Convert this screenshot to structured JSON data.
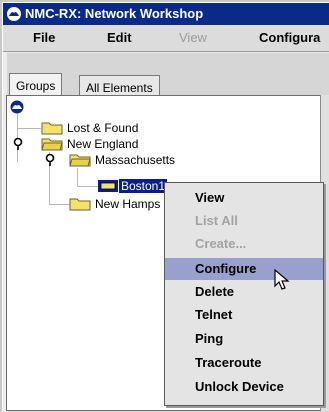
{
  "window": {
    "title": "NMC-RX: Network Workshop"
  },
  "menubar": {
    "items": [
      {
        "label": "File",
        "enabled": true
      },
      {
        "label": "Edit",
        "enabled": true
      },
      {
        "label": "View",
        "enabled": false
      },
      {
        "label": "Configura",
        "enabled": true
      }
    ]
  },
  "tabs": [
    {
      "label": "Groups",
      "active": true
    },
    {
      "label": "All Elements",
      "active": false
    }
  ],
  "tree": {
    "nodes": [
      {
        "label": "Lost & Found"
      },
      {
        "label": "New England"
      },
      {
        "label": "Massachusetts"
      },
      {
        "label": "Boston1",
        "selected": true
      },
      {
        "label": "New Hamps"
      }
    ]
  },
  "context_menu": {
    "items": [
      {
        "label": "View",
        "enabled": true
      },
      {
        "label": "List All",
        "enabled": false
      },
      {
        "label": "Create...",
        "enabled": false
      },
      {
        "label": "Configure",
        "enabled": true,
        "hover": true
      },
      {
        "label": "Delete",
        "enabled": true
      },
      {
        "label": "Telnet",
        "enabled": true
      },
      {
        "label": "Ping",
        "enabled": true
      },
      {
        "label": "Traceroute",
        "enabled": true
      },
      {
        "label": "Unlock Device",
        "enabled": true
      }
    ]
  },
  "colors": {
    "titlebar": "#0a2a8a",
    "selection": "#0a1f8a",
    "menu_hover": "#9aa0ce",
    "folder": "#f4e36a"
  }
}
